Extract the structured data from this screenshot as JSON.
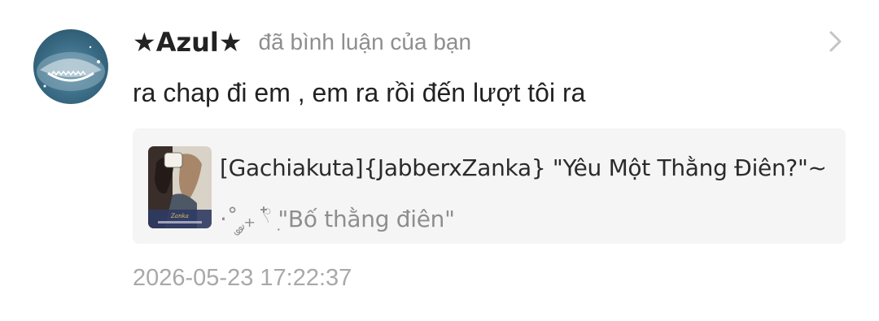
{
  "notification": {
    "username": "★Azul★",
    "action_text": "đã bình luận của bạn",
    "comment_text": "ra chap đi em , em ra rồi đến lượt tôi ra",
    "story": {
      "title": "[Gachiakuta]{JabberxZanka} \"Yêu Một Thằng Điên?\"~",
      "chapter": "·˚ ༘₊ 𓍢ִ໋ \"Bố thằng điên\""
    },
    "timestamp": "2026-05-23 17:22:37",
    "icons": {
      "avatar": "shark-avatar",
      "open": "chevron-right-icon",
      "cover": "story-cover-thumbnail"
    },
    "colors": {
      "username": "#222222",
      "secondary_text": "#8e8e8e",
      "card_background": "#f5f5f6",
      "timestamp": "#a8a8a8"
    }
  }
}
